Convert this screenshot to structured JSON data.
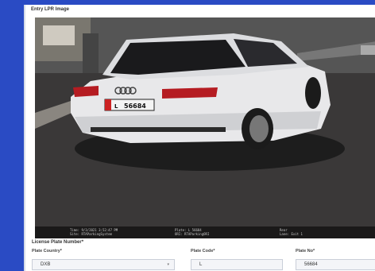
{
  "panel": {
    "title": "Entry LPR Image"
  },
  "image": {
    "plate_text": "56684",
    "plate_code_on_plate": "L",
    "overlay": {
      "time": "Time: 9/3/2021 3:52:47 PM",
      "site": "Site: RTAParkingSystem",
      "plate": "Plate: L 56684",
      "ori": "ORI: RTAParkingORI",
      "rear": "Rear",
      "lane": "Lane: Exit 1"
    }
  },
  "form": {
    "heading": "License Plate Number*",
    "plate_country": {
      "label": "Plate Country*",
      "value": "DXB"
    },
    "plate_code": {
      "label": "Plate Code*",
      "value": "L"
    },
    "plate_no": {
      "label": "Plate No*",
      "value": "56684"
    }
  },
  "colors": {
    "frame": "#2a4bc4",
    "panel": "#ffffff",
    "field_bg": "#f4f5f8"
  }
}
